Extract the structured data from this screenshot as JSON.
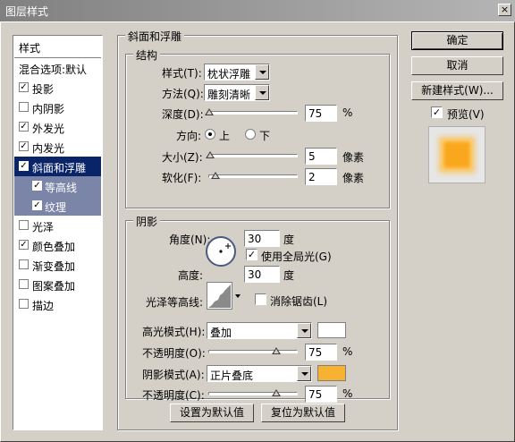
{
  "window": {
    "title": "图层样式",
    "close_glyph": "×"
  },
  "styles_list": {
    "header": "样式",
    "blend_default": "混合选项:默认",
    "items": [
      {
        "label": "投影",
        "checked": true
      },
      {
        "label": "内阴影",
        "checked": false
      },
      {
        "label": "外发光",
        "checked": true
      },
      {
        "label": "内发光",
        "checked": true
      },
      {
        "label": "斜面和浮雕",
        "checked": true
      },
      {
        "label": "等高线",
        "checked": true
      },
      {
        "label": "纹理",
        "checked": true
      },
      {
        "label": "光泽",
        "checked": false
      },
      {
        "label": "颜色叠加",
        "checked": true
      },
      {
        "label": "渐变叠加",
        "checked": false
      },
      {
        "label": "图案叠加",
        "checked": false
      },
      {
        "label": "描边",
        "checked": false
      }
    ],
    "check_glyph": "✓"
  },
  "bevel": {
    "group_title": "斜面和浮雕",
    "structure": {
      "title": "结构",
      "style_label": "样式(T):",
      "style_value": "枕状浮雕",
      "technique_label": "方法(Q):",
      "technique_value": "雕刻清晰",
      "depth_label": "深度(D):",
      "depth_value": "75",
      "depth_unit": "%",
      "direction_label": "方向:",
      "direction_up": "上",
      "direction_down": "下",
      "direction_selected": "up",
      "size_label": "大小(Z):",
      "size_value": "5",
      "size_unit": "像素",
      "soften_label": "软化(F):",
      "soften_value": "2",
      "soften_unit": "像素"
    },
    "shading": {
      "title": "阴影",
      "angle_label": "角度(N):",
      "angle_value": "30",
      "angle_unit": "度",
      "global_light_label": "使用全局光(G)",
      "global_light_checked": true,
      "altitude_label": "高度:",
      "altitude_value": "30",
      "altitude_unit": "度",
      "gloss_contour_label": "光泽等高线:",
      "anti_alias_label": "消除锯齿(L)",
      "anti_alias_checked": false,
      "highlight_mode_label": "高光模式(H):",
      "highlight_mode_value": "叠加",
      "highlight_color": "#ffffff",
      "highlight_opacity_label": "不透明度(O):",
      "highlight_opacity_value": "75",
      "shadow_mode_label": "阴影模式(A):",
      "shadow_mode_value": "正片叠底",
      "shadow_color": "#f7b232",
      "shadow_opacity_label": "不透明度(C):",
      "shadow_opacity_value": "75",
      "percent_unit": "%"
    },
    "make_default": "设置为默认值",
    "reset_default": "复位为默认值"
  },
  "right_panel": {
    "ok": "确定",
    "cancel": "取消",
    "new_style": "新建样式(W)...",
    "preview_label": "预览(V)",
    "preview_checked": true,
    "preview_fill": "#f9a81e"
  }
}
